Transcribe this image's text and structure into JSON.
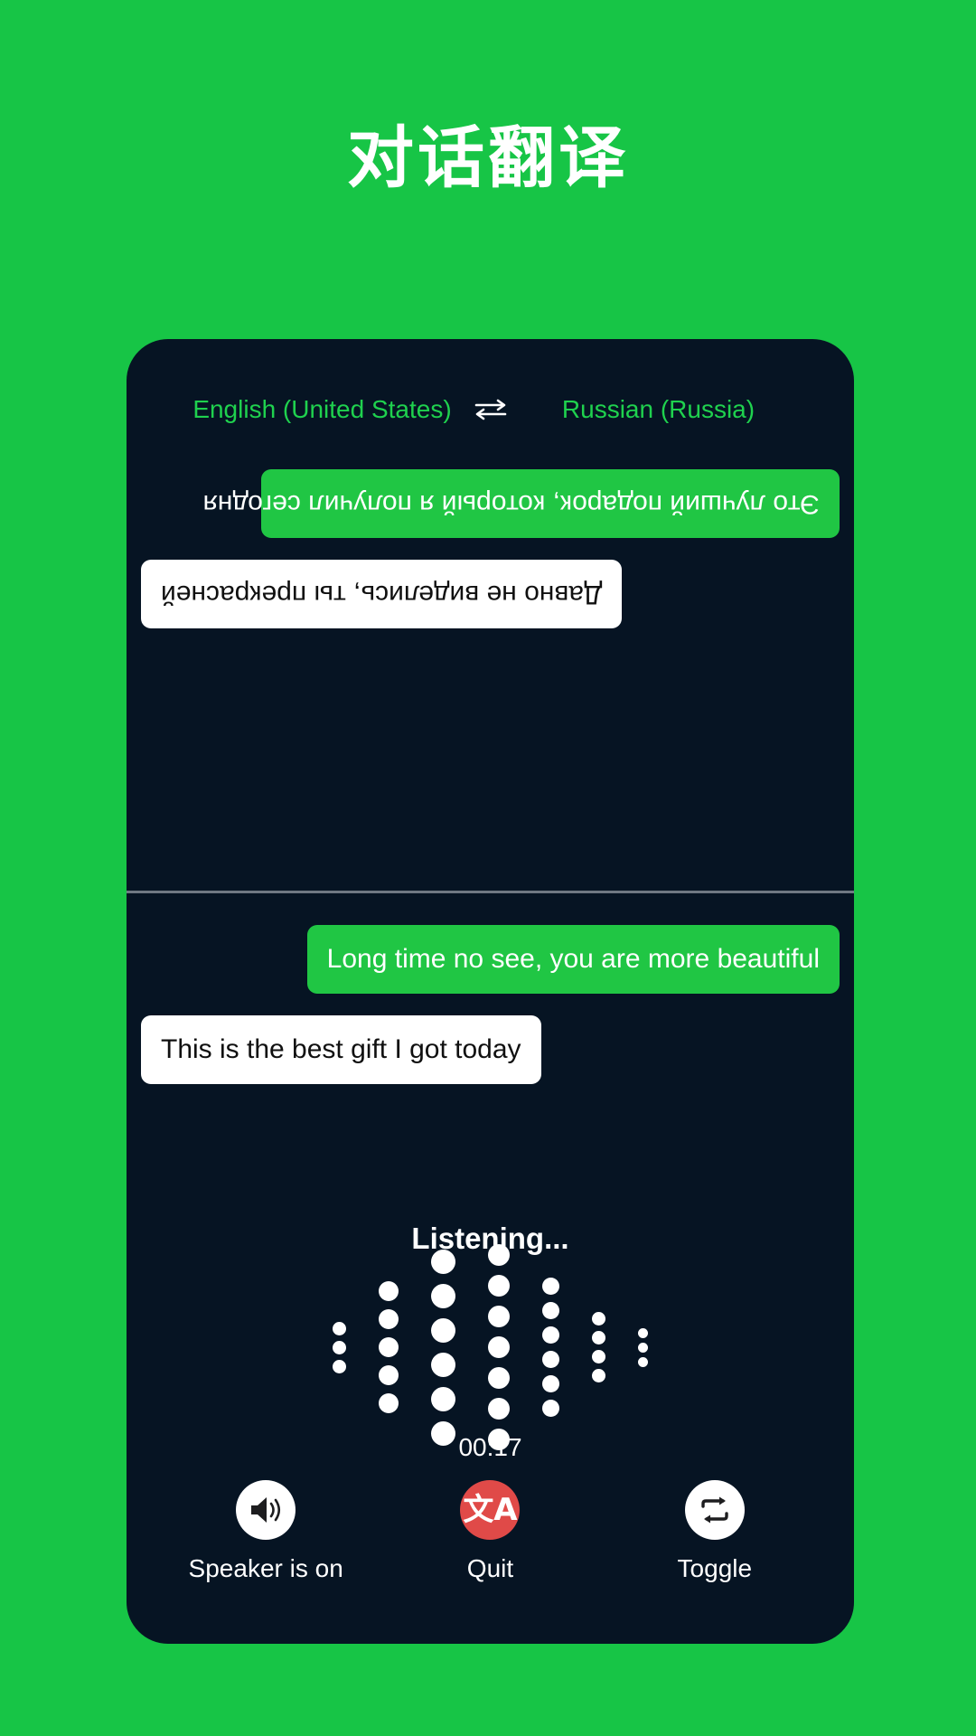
{
  "page": {
    "title": "对话翻译",
    "background_color": "#17c546",
    "card_color": "#061423",
    "accent_green": "#20c644",
    "accent_red": "#e04a48"
  },
  "language_bar": {
    "source_language": "English (United States)",
    "target_language": "Russian (Russia)",
    "swap_icon": "swap-horizontal-icon"
  },
  "conversation": {
    "top_pane_rotated": true,
    "top_messages": [
      {
        "text": "Это лучший подарок, который я получил сегодня",
        "style": "green",
        "align": "left"
      },
      {
        "text": "Давно не виделись, ты прекрасней",
        "style": "white",
        "align": "right"
      }
    ],
    "bottom_messages": [
      {
        "text": "Long time no see, you are more beautiful",
        "style": "green",
        "align": "right"
      },
      {
        "text": "This is the best gift I got today",
        "style": "white",
        "align": "left"
      }
    ]
  },
  "status": {
    "listening_label": "Listening...",
    "timer": "00:17"
  },
  "waveform": {
    "columns": [
      {
        "dots": 3,
        "size": 15
      },
      {
        "dots": 5,
        "size": 22
      },
      {
        "dots": 6,
        "size": 27
      },
      {
        "dots": 7,
        "size": 24
      },
      {
        "dots": 6,
        "size": 19
      },
      {
        "dots": 4,
        "size": 15
      },
      {
        "dots": 3,
        "size": 11
      }
    ]
  },
  "controls": [
    {
      "label": "Speaker is on",
      "icon": "speaker-on-icon",
      "circle_style": "white"
    },
    {
      "label": "Quit",
      "icon": "translate-icon",
      "circle_style": "red"
    },
    {
      "label": "Toggle",
      "icon": "toggle-swap-icon",
      "circle_style": "white"
    }
  ]
}
